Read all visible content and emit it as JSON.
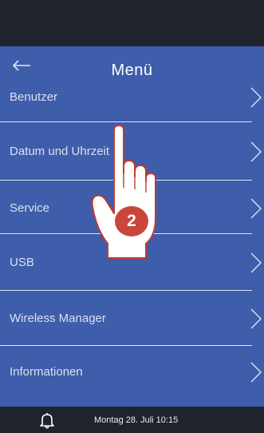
{
  "header": {
    "title": "Menü",
    "back_icon": "arrow-left-icon"
  },
  "menu": {
    "items": [
      {
        "label": "Benutzer",
        "icon": "chevron-right-icon"
      },
      {
        "label": "Datum und Uhrzeit",
        "icon": "chevron-right-icon"
      },
      {
        "label": "Service",
        "icon": "chevron-right-icon"
      },
      {
        "label": "USB",
        "icon": "chevron-right-icon"
      },
      {
        "label": "Wireless Manager",
        "icon": "chevron-right-icon"
      },
      {
        "label": "Informationen",
        "icon": "chevron-right-icon"
      }
    ]
  },
  "annotation": {
    "step_number": "2",
    "pointer_icon": "hand-pointer-icon"
  },
  "status_bar": {
    "bell_icon": "bell-icon",
    "datetime": "Montag 28. Juli 10:15"
  },
  "colors": {
    "top_bar": "#1e232c",
    "menu_background": "#3e5daa",
    "divider": "#dfe5f3",
    "badge": "#c9463b"
  }
}
